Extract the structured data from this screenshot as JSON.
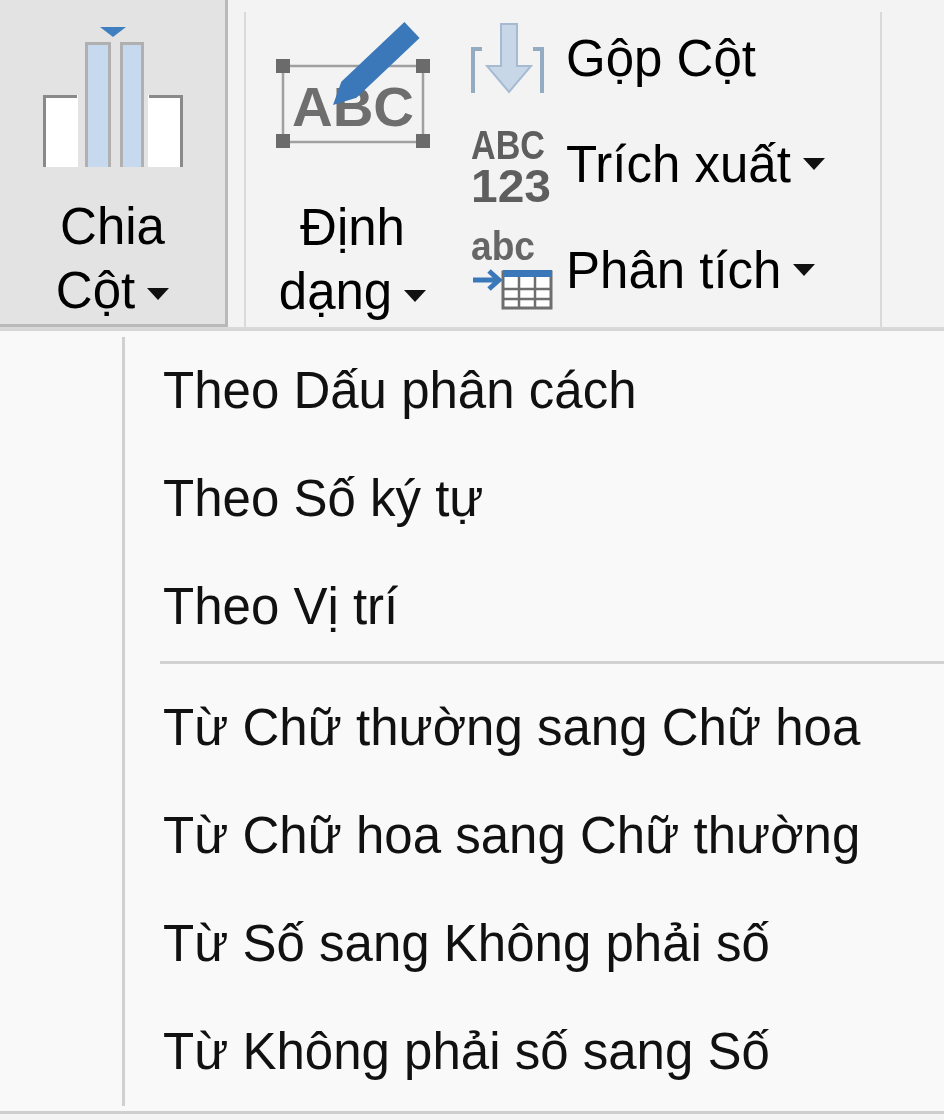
{
  "ribbon": {
    "large_buttons": [
      {
        "kind": "split",
        "label": "Chia Cột",
        "expanded": true,
        "dropdown": true
      },
      {
        "kind": "format",
        "label": "Định dạng",
        "icon_text": "ABC",
        "expanded": false,
        "dropdown": true
      }
    ],
    "small_buttons": [
      {
        "kind": "merge",
        "label": "Gộp Cột",
        "dropdown": false
      },
      {
        "kind": "extract",
        "label": "Trích xuất",
        "icon_lines": [
          "ABC",
          "123"
        ],
        "dropdown": true
      },
      {
        "kind": "parse",
        "label": "Phân tích",
        "icon_text": "abc",
        "dropdown": true
      }
    ]
  },
  "menu": {
    "sections": [
      {
        "items": [
          {
            "label": "Theo Dấu phân cách"
          },
          {
            "label": "Theo Số ký tự"
          },
          {
            "label": "Theo Vị trí"
          }
        ]
      },
      {
        "items": [
          {
            "label": "Từ Chữ thường sang Chữ hoa"
          },
          {
            "label": "Từ Chữ hoa sang Chữ thường"
          },
          {
            "label": "Từ Số sang Không phải số"
          },
          {
            "label": "Từ Không phải số sang Số"
          }
        ]
      }
    ]
  }
}
